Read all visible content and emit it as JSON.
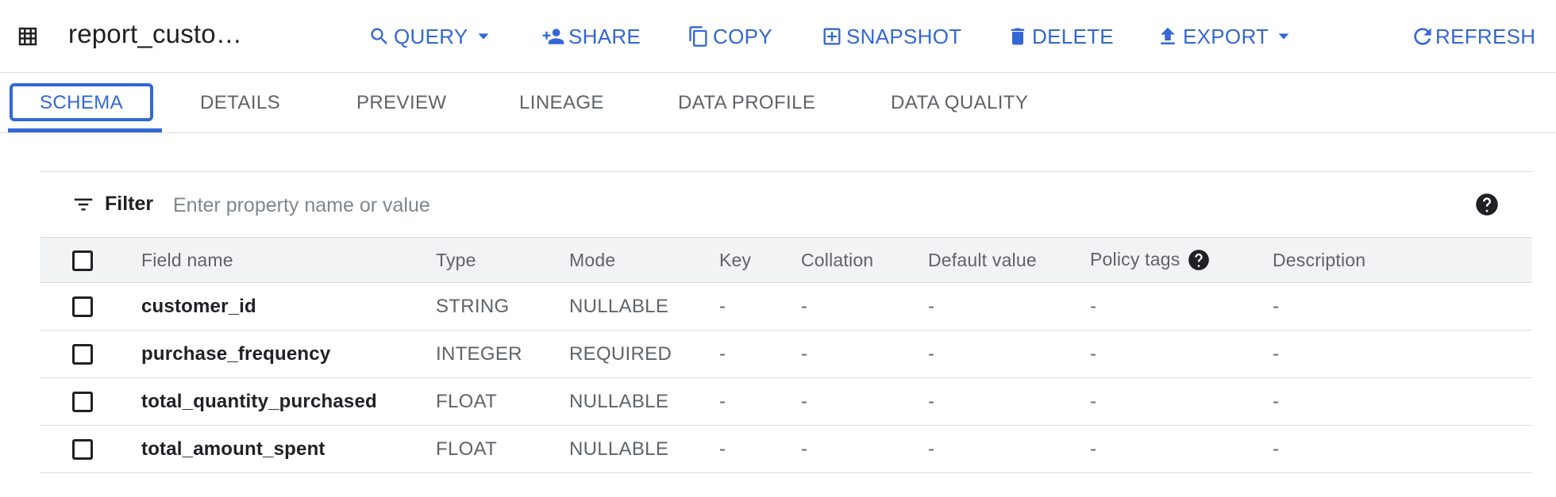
{
  "toolbar": {
    "title": "report_custo…",
    "table_icon": "table-grid-icon",
    "buttons": {
      "query": "QUERY",
      "share": "SHARE",
      "copy": "COPY",
      "snapshot": "SNAPSHOT",
      "delete": "DELETE",
      "export": "EXPORT",
      "refresh": "REFRESH"
    }
  },
  "tabs": [
    "SCHEMA",
    "DETAILS",
    "PREVIEW",
    "LINEAGE",
    "DATA PROFILE",
    "DATA QUALITY"
  ],
  "active_tab": "SCHEMA",
  "filter": {
    "label": "Filter",
    "placeholder": "Enter property name or value"
  },
  "table": {
    "headers": {
      "field_name": "Field name",
      "type": "Type",
      "mode": "Mode",
      "key": "Key",
      "collation": "Collation",
      "default_value": "Default value",
      "policy_tags": "Policy tags",
      "description": "Description"
    },
    "rows": [
      {
        "field_name": "customer_id",
        "type": "STRING",
        "mode": "NULLABLE",
        "key": "-",
        "collation": "-",
        "default_value": "-",
        "policy_tags": "-",
        "description": "-"
      },
      {
        "field_name": "purchase_frequency",
        "type": "INTEGER",
        "mode": "REQUIRED",
        "key": "-",
        "collation": "-",
        "default_value": "-",
        "policy_tags": "-",
        "description": "-"
      },
      {
        "field_name": "total_quantity_purchased",
        "type": "FLOAT",
        "mode": "NULLABLE",
        "key": "-",
        "collation": "-",
        "default_value": "-",
        "policy_tags": "-",
        "description": "-"
      },
      {
        "field_name": "total_amount_spent",
        "type": "FLOAT",
        "mode": "NULLABLE",
        "key": "-",
        "collation": "-",
        "default_value": "-",
        "policy_tags": "-",
        "description": "-"
      }
    ]
  },
  "colors": {
    "accent": "#3367d6",
    "header_bg": "#f1f3f4",
    "divider": "#dadce0",
    "muted_text": "#5f6368",
    "text": "#202124"
  }
}
